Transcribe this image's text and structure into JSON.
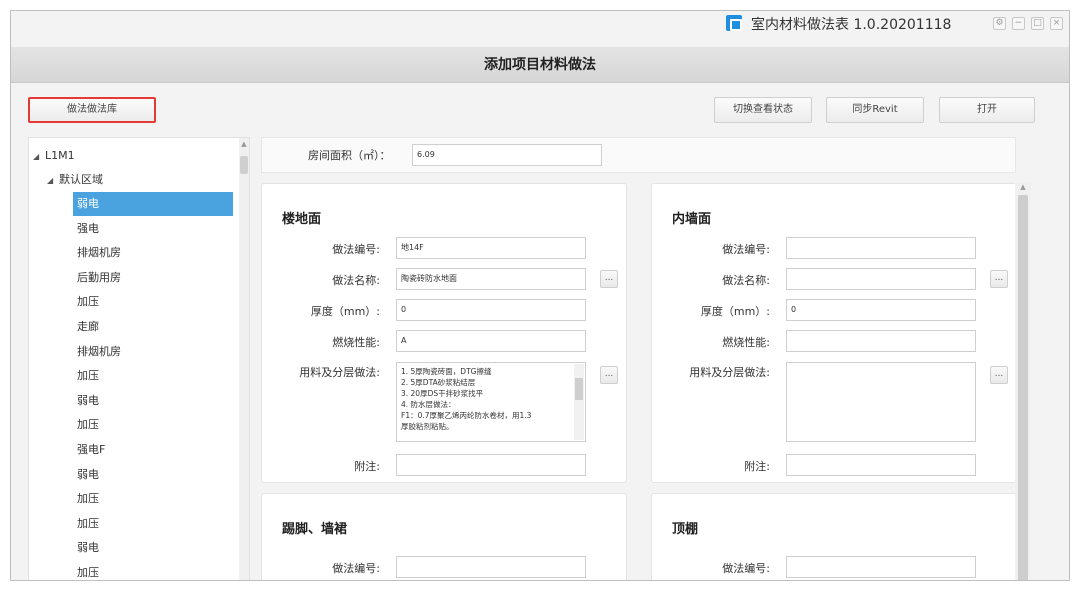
{
  "window": {
    "title": "室内材料做法表 1.0.20201118",
    "controls": [
      "⚙",
      "−",
      "□",
      "×"
    ]
  },
  "dialog": {
    "title": "添加项目材料做法"
  },
  "toolbar": {
    "export_label": "做法做法库",
    "view_label": "切换查看状态",
    "sync_label": "同步Revit",
    "open_label": "打开"
  },
  "tree": {
    "root": "L1M1",
    "area": "默认区域",
    "items": [
      "弱电",
      "强电",
      "排烟机房",
      "后勤用房",
      "加压",
      "走廊",
      "排烟机房",
      "加压",
      "弱电",
      "加压",
      "强电F",
      "弱电",
      "加压",
      "加压",
      "弱电",
      "加压"
    ],
    "selected_index": 0
  },
  "room": {
    "area_label": "房间面积（㎡）：",
    "area_value": "6.09"
  },
  "floor": {
    "title": "楼地面",
    "code_label": "做法编号:",
    "code_value": "地14F",
    "name_label": "做法名称:",
    "name_value": "陶瓷砖防水地面",
    "thickness_label": "厚度（mm）:",
    "thickness_value": "0",
    "fire_label": "燃烧性能:",
    "fire_value": "A",
    "layers_label": "用料及分层做法:",
    "layers_value": "1. 5厚陶瓷砖面，DTG擦缝\n2. 5厚DTA砂浆粘结层\n3. 20厚DS干拌砂浆找平\n4. 防水层做法：\nF1：0.7厚聚乙烯丙纶防水卷材，用1.3\n厚胶粘剂粘贴。",
    "note_label": "附注:",
    "note_value": "",
    "more_label": "..."
  },
  "inner_wall": {
    "title": "内墙面",
    "code_label": "做法编号:",
    "code_value": "",
    "name_label": "做法名称:",
    "name_value": "",
    "thickness_label": "厚度（mm）:",
    "thickness_value": "0",
    "fire_label": "燃烧性能:",
    "fire_value": "",
    "layers_label": "用料及分层做法:",
    "layers_value": "",
    "note_label": "附注:",
    "note_value": "",
    "more_label": "..."
  },
  "skirting": {
    "title": "踢脚、墙裙",
    "code_label": "做法编号:",
    "code_value": ""
  },
  "ceiling": {
    "title": "顶棚",
    "code_label": "做法编号:",
    "code_value": ""
  }
}
